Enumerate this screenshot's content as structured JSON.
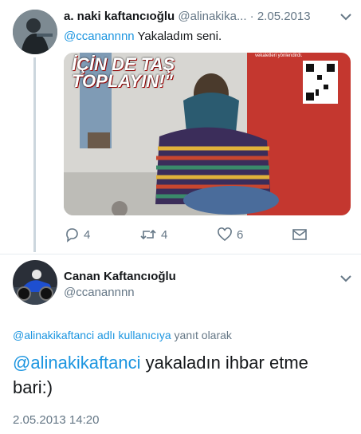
{
  "tweet": {
    "author_name": "a. naki kaftancıoğlu",
    "author_handle": "@alinakika...",
    "sep": "·",
    "date": "2.05.2013",
    "mention": "@ccanannnn",
    "text": " Yakaladım seni.",
    "image": {
      "headline_line1": "İÇİN DE TAŞ",
      "headline_line2": "TOPLAYIN!\"",
      "corner_text": "vekaletleri yönlendirdi."
    },
    "actions": {
      "replies": "4",
      "retweets": "4",
      "likes": "6"
    }
  },
  "reply": {
    "author_name": "Canan Kaftancıoğlu",
    "author_handle": "@ccanannnn",
    "replying_to_handle": "@alinakikaftanci adlı kullanıcıya",
    "replying_to_suffix": " yanıt olarak",
    "mention": "@alinakikaftanci",
    "text_line1": " yakaladın ihbar etme",
    "text_line2": "bari:)",
    "timestamp": "2.05.2013 14:20"
  },
  "colors": {
    "link": "#1b95e0",
    "muted": "#657786",
    "thread_line": "#ccd6dd",
    "divider": "#e6ecf0"
  }
}
